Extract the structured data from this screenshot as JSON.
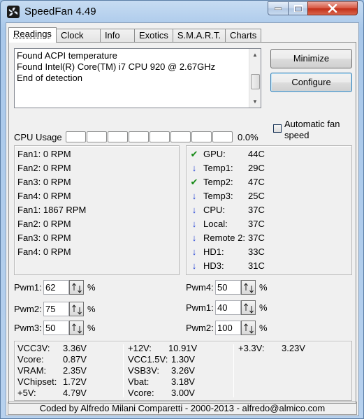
{
  "window": {
    "title": "SpeedFan 4.49"
  },
  "tabs": [
    "Readings",
    "Clock",
    "Info",
    "Exotics",
    "S.M.A.R.T.",
    "Charts"
  ],
  "log": {
    "lines": [
      "Found ACPI temperature",
      "Found Intel(R) Core(TM) i7 CPU 920 @ 2.67GHz",
      "End of detection"
    ]
  },
  "buttons": {
    "minimize": "Minimize",
    "configure": "Configure"
  },
  "auto_fan": {
    "label": "Automatic fan speed",
    "checked": false
  },
  "cpu": {
    "label": "CPU Usage",
    "value": "0.0%",
    "usage_fraction": 0.0
  },
  "fans": [
    {
      "label": "Fan1:",
      "value": "0 RPM"
    },
    {
      "label": "Fan2:",
      "value": "0 RPM"
    },
    {
      "label": "Fan3:",
      "value": "0 RPM"
    },
    {
      "label": "Fan4:",
      "value": "0 RPM"
    },
    {
      "label": "Fan1:",
      "value": "1867 RPM"
    },
    {
      "label": "Fan2:",
      "value": "0 RPM"
    },
    {
      "label": "Fan3:",
      "value": "0 RPM"
    },
    {
      "label": "Fan4:",
      "value": "0 RPM"
    }
  ],
  "temps": [
    {
      "label": "GPU:",
      "value": "44C",
      "icon": "check-icon"
    },
    {
      "label": "Temp1:",
      "value": "29C",
      "icon": "arrow-down-icon"
    },
    {
      "label": "Temp2:",
      "value": "47C",
      "icon": "check-icon"
    },
    {
      "label": "Temp3:",
      "value": "25C",
      "icon": "arrow-down-icon"
    },
    {
      "label": "CPU:",
      "value": "37C",
      "icon": "arrow-down-icon"
    },
    {
      "label": "Local:",
      "value": "37C",
      "icon": "arrow-down-icon"
    },
    {
      "label": "Remote 2:",
      "value": "37C",
      "icon": "arrow-down-icon"
    },
    {
      "label": "HD1:",
      "value": "33C",
      "icon": "arrow-down-icon"
    },
    {
      "label": "HD3:",
      "value": "31C",
      "icon": "arrow-down-icon"
    }
  ],
  "pwm_left": [
    {
      "label": "Pwm1:",
      "value": "62",
      "unit": "%"
    },
    {
      "label": "Pwm2:",
      "value": "75",
      "unit": "%"
    },
    {
      "label": "Pwm3:",
      "value": "50",
      "unit": "%"
    }
  ],
  "pwm_right": [
    {
      "label": "Pwm4:",
      "value": "50",
      "unit": "%"
    },
    {
      "label": "Pwm1:",
      "value": "40",
      "unit": "%"
    },
    {
      "label": "Pwm2:",
      "value": "100",
      "unit": "%"
    }
  ],
  "voltages": [
    [
      {
        "label": "VCC3V:",
        "value": "3.36V"
      },
      {
        "label": "Vcore:",
        "value": "0.87V"
      },
      {
        "label": "VRAM:",
        "value": "2.35V"
      },
      {
        "label": "VChipset:",
        "value": "1.72V"
      },
      {
        "label": "+5V:",
        "value": "4.79V"
      }
    ],
    [
      {
        "label": "+12V:",
        "value": "10.91V"
      },
      {
        "label": "VCC1.5V:",
        "value": "1.30V"
      },
      {
        "label": "VSB3V:",
        "value": "3.26V"
      },
      {
        "label": "Vbat:",
        "value": "3.18V"
      },
      {
        "label": "Vcore:",
        "value": "3.00V"
      }
    ],
    [
      {
        "label": "+3.3V:",
        "value": "3.23V"
      }
    ]
  ],
  "status": "Coded by Alfredo Milani Comparetti - 2000-2013 - alfredo@almico.com",
  "colors": {
    "ok": "#168a16",
    "down": "#1f3fd6",
    "close": "#c22f18"
  }
}
